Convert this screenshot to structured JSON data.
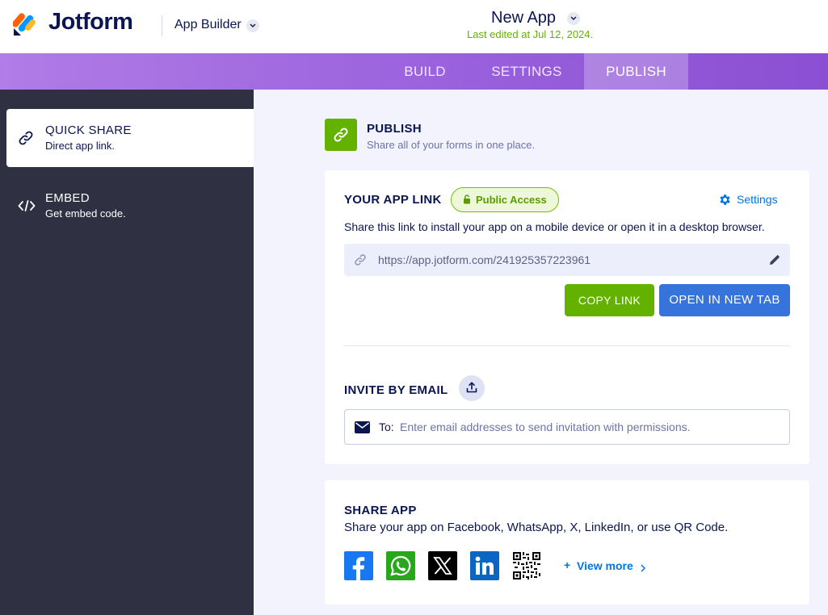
{
  "header": {
    "brand": "Jotform",
    "product": "App Builder",
    "app_title": "New App",
    "last_edited": "Last edited at Jul 12, 2024."
  },
  "tabs": [
    {
      "label": "BUILD",
      "active": false
    },
    {
      "label": "SETTINGS",
      "active": false
    },
    {
      "label": "PUBLISH",
      "active": true
    }
  ],
  "sidebar": {
    "items": [
      {
        "title": "QUICK SHARE",
        "subtitle": "Direct app link.",
        "icon": "link-icon",
        "active": true
      },
      {
        "title": "EMBED",
        "subtitle": "Get embed code.",
        "icon": "code-icon",
        "active": false
      }
    ]
  },
  "publish": {
    "title": "PUBLISH",
    "subtitle": "Share all of your forms in one place.",
    "icon": "link-icon"
  },
  "app_link": {
    "heading": "YOUR APP LINK",
    "badge": "Public Access",
    "settings_label": "Settings",
    "description": "Share this link to install your app on a mobile device or open it in a desktop browser.",
    "url": "https://app.jotform.com/241925357223961",
    "copy_label": "COPY LINK",
    "open_label": "OPEN IN NEW TAB"
  },
  "invite": {
    "heading": "INVITE BY EMAIL",
    "to_label": "To:",
    "placeholder": "Enter email addresses to send invitation with permissions.",
    "value": ""
  },
  "share_app": {
    "heading": "SHARE APP",
    "description": "Share your app on Facebook, WhatsApp, X, LinkedIn, or use QR Code.",
    "platforms": [
      "Facebook",
      "WhatsApp",
      "X",
      "LinkedIn",
      "QR Code"
    ],
    "view_more_label": "View more"
  },
  "colors": {
    "accent_green": "#64b200",
    "accent_blue": "#3673db",
    "tab_purple": "#9b63dd",
    "sidebar_dark": "#2f3142",
    "navy_text": "#0a1551"
  }
}
